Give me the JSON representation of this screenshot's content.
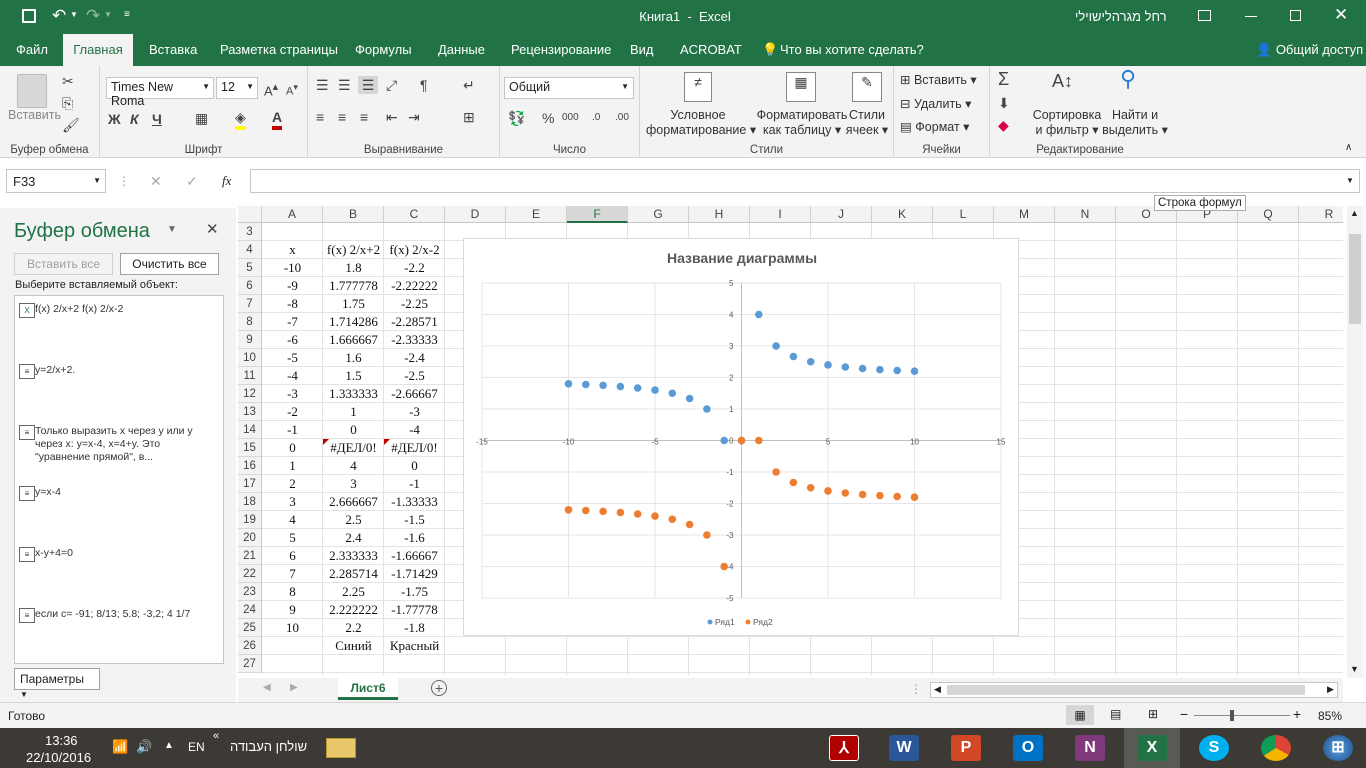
{
  "titlebar": {
    "title": "Книга1  -  Excel",
    "user": "רחל מגרהלישוילי"
  },
  "menu": {
    "tabs": [
      "Файл",
      "Главная",
      "Вставка",
      "Разметка страницы",
      "Формулы",
      "Данные",
      "Рецензирование",
      "Вид",
      "ACROBAT",
      "Что вы хотите сделать?"
    ],
    "share": "Общий доступ"
  },
  "ribbon": {
    "clipboard": {
      "paste": "Вставить",
      "label": "Буфер обмена"
    },
    "font": {
      "name": "Times New Roma",
      "size": "12",
      "bold": "Ж",
      "italic": "К",
      "underline": "Ч",
      "label": "Шрифт"
    },
    "align": {
      "label": "Выравнивание"
    },
    "number": {
      "format": "Общий",
      "label": "Число"
    },
    "styles": {
      "cond1": "Условное",
      "cond2": "форматирование",
      "table1": "Форматировать",
      "table2": "как таблицу",
      "cell1": "Стили",
      "cell2": "ячеек",
      "label": "Стили"
    },
    "cells": {
      "insert": "Вставить",
      "delete": "Удалить",
      "format": "Формат",
      "label": "Ячейки"
    },
    "editing": {
      "sort1": "Сортировка",
      "sort2": "и фильтр",
      "find1": "Найти и",
      "find2": "выделить",
      "label": "Редактирование"
    }
  },
  "formula": {
    "namebox": "F33",
    "fx": "fx",
    "tooltip": "Строка формул",
    "value": ""
  },
  "clipboard_pane": {
    "title": "Буфер обмена",
    "paste_all": "Вставить все",
    "clear_all": "Очистить все",
    "prompt": "Выберите вставляемый объект:",
    "items": [
      "f(x) 2/x+2 f(x) 2/x-2",
      "y=2/x+2.",
      "Только выразить x через y или y через x: y=x-4, x=4+y. Это \"уравнение прямой\", в...",
      "y=x-4",
      "x-y+4=0",
      "если c= -91; 8/13; 5.8; -3,2; 4 1/7"
    ],
    "options": "Параметры"
  },
  "sheet": {
    "columns": [
      "A",
      "B",
      "C",
      "D",
      "E",
      "F",
      "G",
      "H",
      "I",
      "J",
      "K",
      "L",
      "M",
      "N",
      "O",
      "P",
      "Q",
      "R"
    ],
    "rows": [
      {
        "n": "3",
        "a": "",
        "b": "",
        "c": ""
      },
      {
        "n": "4",
        "a": "x",
        "b": "f(x) 2/x+2",
        "c": "f(x) 2/x-2"
      },
      {
        "n": "5",
        "a": "-10",
        "b": "1.8",
        "c": "-2.2"
      },
      {
        "n": "6",
        "a": "-9",
        "b": "1.777778",
        "c": "-2.22222"
      },
      {
        "n": "7",
        "a": "-8",
        "b": "1.75",
        "c": "-2.25"
      },
      {
        "n": "8",
        "a": "-7",
        "b": "1.714286",
        "c": "-2.28571"
      },
      {
        "n": "9",
        "a": "-6",
        "b": "1.666667",
        "c": "-2.33333"
      },
      {
        "n": "10",
        "a": "-5",
        "b": "1.6",
        "c": "-2.4"
      },
      {
        "n": "11",
        "a": "-4",
        "b": "1.5",
        "c": "-2.5"
      },
      {
        "n": "12",
        "a": "-3",
        "b": "1.333333",
        "c": "-2.66667"
      },
      {
        "n": "13",
        "a": "-2",
        "b": "1",
        "c": "-3"
      },
      {
        "n": "14",
        "a": "-1",
        "b": "0",
        "c": "-4"
      },
      {
        "n": "15",
        "a": "0",
        "b": "#ДЕЛ/0!",
        "c": "#ДЕЛ/0!"
      },
      {
        "n": "16",
        "a": "1",
        "b": "4",
        "c": "0"
      },
      {
        "n": "17",
        "a": "2",
        "b": "3",
        "c": "-1"
      },
      {
        "n": "18",
        "a": "3",
        "b": "2.666667",
        "c": "-1.33333"
      },
      {
        "n": "19",
        "a": "4",
        "b": "2.5",
        "c": "-1.5"
      },
      {
        "n": "20",
        "a": "5",
        "b": "2.4",
        "c": "-1.6"
      },
      {
        "n": "21",
        "a": "6",
        "b": "2.333333",
        "c": "-1.66667"
      },
      {
        "n": "22",
        "a": "7",
        "b": "2.285714",
        "c": "-1.71429"
      },
      {
        "n": "23",
        "a": "8",
        "b": "2.25",
        "c": "-1.75"
      },
      {
        "n": "24",
        "a": "9",
        "b": "2.222222",
        "c": "-1.77778"
      },
      {
        "n": "25",
        "a": "10",
        "b": "2.2",
        "c": "-1.8"
      },
      {
        "n": "26",
        "a": "",
        "b": "Синий",
        "c": "Красный"
      },
      {
        "n": "27",
        "a": "",
        "b": "",
        "c": ""
      }
    ],
    "tab": "Лист6"
  },
  "chart_data": {
    "type": "scatter",
    "title": "Название диаграммы",
    "xlim": [
      -15,
      15
    ],
    "ylim": [
      -5,
      5
    ],
    "xticks": [
      -15,
      -10,
      -5,
      0,
      5,
      10,
      15
    ],
    "yticks": [
      -5,
      -4,
      -3,
      -2,
      -1,
      0,
      1,
      2,
      3,
      4,
      5
    ],
    "grid": true,
    "legend_position": "bottom",
    "series": [
      {
        "name": "Ряд1",
        "color": "#5b9bd5",
        "x": [
          -10,
          -9,
          -8,
          -7,
          -6,
          -5,
          -4,
          -3,
          -2,
          -1,
          0,
          1,
          2,
          3,
          4,
          5,
          6,
          7,
          8,
          9,
          10
        ],
        "y": [
          1.8,
          1.777778,
          1.75,
          1.714286,
          1.666667,
          1.6,
          1.5,
          1.333333,
          1,
          0,
          0,
          4,
          3,
          2.666667,
          2.5,
          2.4,
          2.333333,
          2.285714,
          2.25,
          2.222222,
          2.2
        ]
      },
      {
        "name": "Ряд2",
        "color": "#ed7d31",
        "x": [
          -10,
          -9,
          -8,
          -7,
          -6,
          -5,
          -4,
          -3,
          -2,
          -1,
          0,
          1,
          2,
          3,
          4,
          5,
          6,
          7,
          8,
          9,
          10
        ],
        "y": [
          -2.2,
          -2.22222,
          -2.25,
          -2.28571,
          -2.33333,
          -2.4,
          -2.5,
          -2.66667,
          -3,
          -4,
          0,
          0,
          -1,
          -1.33333,
          -1.5,
          -1.6,
          -1.66667,
          -1.71429,
          -1.75,
          -1.77778,
          -1.8
        ]
      }
    ]
  },
  "status": {
    "ready": "Готово",
    "zoom": "85%"
  },
  "taskbar": {
    "time": "13:36",
    "date": "22/10/2016",
    "lang": "EN",
    "desktop": "שולחן העבודה"
  }
}
